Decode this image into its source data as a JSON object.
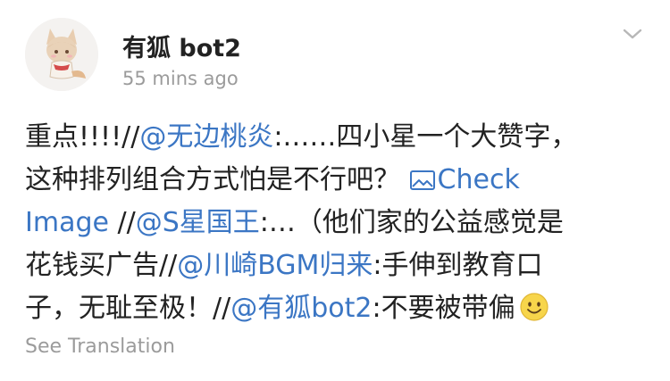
{
  "post": {
    "author": "有狐 bot2",
    "timestamp": "55 mins ago",
    "content": {
      "l1_text_a": "重点!!!!//",
      "l1_mention_1": "@无边桃炎",
      "l1_text_b": ":……四小星一个大赞字，",
      "l2_text_a": "这种排列组合方式怕是不行吧？ ",
      "l2_check": "Check",
      "l3_image": "Image",
      "l3_text_a": " //",
      "l3_mention_2": "@S星国王",
      "l3_text_b": ":…（他们家的公益感觉是",
      "l4_text_a": "花钱买广告//",
      "l4_mention_3": "@川崎BGM归来",
      "l4_text_b": ":手伸到教育口",
      "l5_text_a": "子，无耻至极！//",
      "l5_mention_4": "@有狐bot2",
      "l5_text_b": ":不要被带偏"
    },
    "see_translation": "See Translation"
  }
}
